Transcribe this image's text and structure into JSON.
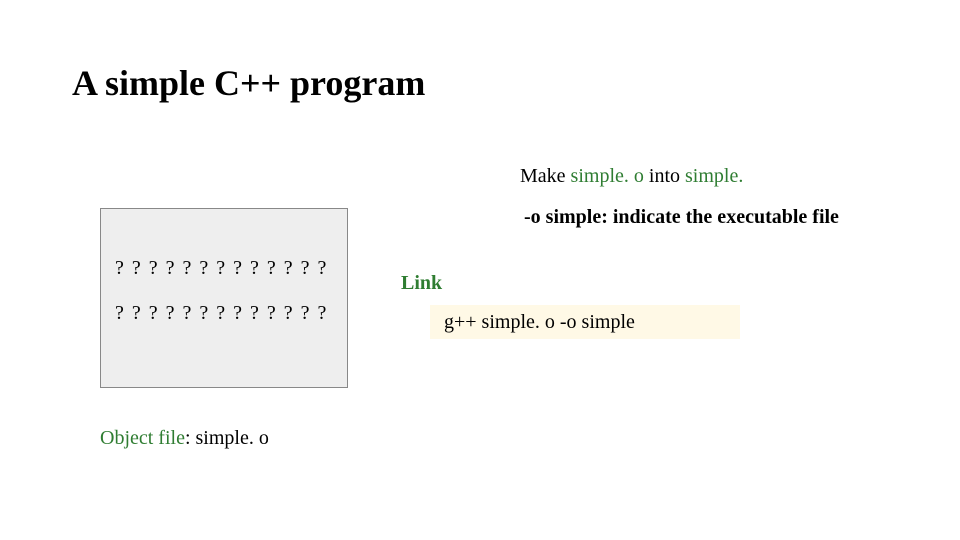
{
  "title": "A simple C++ program",
  "subtitle": {
    "prefix": "Make ",
    "file1": "simple. o",
    "mid": " into ",
    "file2": "simple."
  },
  "note": "-o simple: indicate the executable file",
  "codebox": {
    "line1": "? ? ? ? ? ? ? ? ? ? ? ? ?",
    "line2": "? ? ? ? ? ? ? ? ? ? ? ? ?"
  },
  "link_label": "Link",
  "command": "g++  simple. o  -o  simple",
  "object_file": {
    "label": "Object file",
    "value": ": simple. o"
  }
}
